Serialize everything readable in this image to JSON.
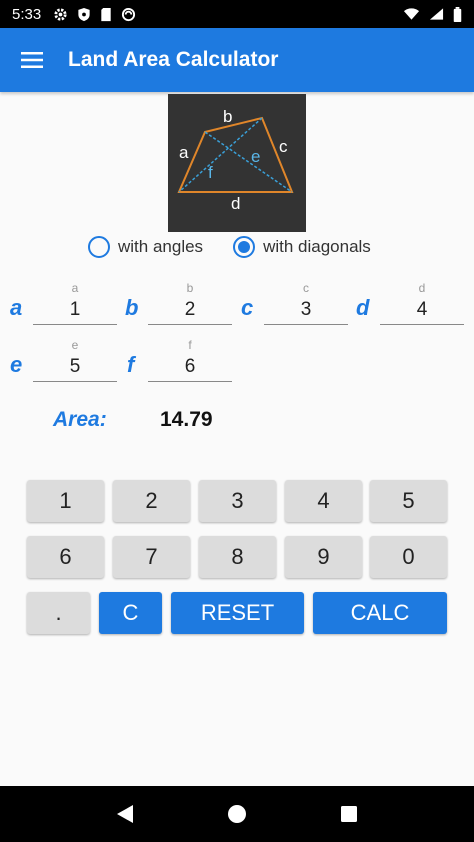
{
  "status_bar": {
    "time": "5:33"
  },
  "app_bar": {
    "title": "Land Area Calculator"
  },
  "diagram": {
    "labels": {
      "a": "a",
      "b": "b",
      "c": "c",
      "d": "d",
      "e": "e",
      "f": "f"
    }
  },
  "mode": {
    "options": [
      {
        "label": "with angles",
        "selected": false
      },
      {
        "label": "with diagonals",
        "selected": true
      }
    ]
  },
  "fields": [
    {
      "name": "a",
      "hint": "a",
      "value": "1"
    },
    {
      "name": "b",
      "hint": "b",
      "value": "2"
    },
    {
      "name": "c",
      "hint": "c",
      "value": "3"
    },
    {
      "name": "d",
      "hint": "d",
      "value": "4"
    },
    {
      "name": "e",
      "hint": "e",
      "value": "5"
    },
    {
      "name": "f",
      "hint": "f",
      "value": "6"
    }
  ],
  "result": {
    "label": "Area:",
    "value": "14.79"
  },
  "keypad": {
    "digits": [
      "1",
      "2",
      "3",
      "4",
      "5",
      "6",
      "7",
      "8",
      "9",
      "0"
    ],
    "dot": ".",
    "clear": "C",
    "reset": "RESET",
    "calc": "CALC"
  },
  "colors": {
    "accent": "#1e7ae0",
    "key_bg": "#dcdcdc",
    "diagram_bg": "#333333",
    "diagram_line": "#e0862a"
  }
}
